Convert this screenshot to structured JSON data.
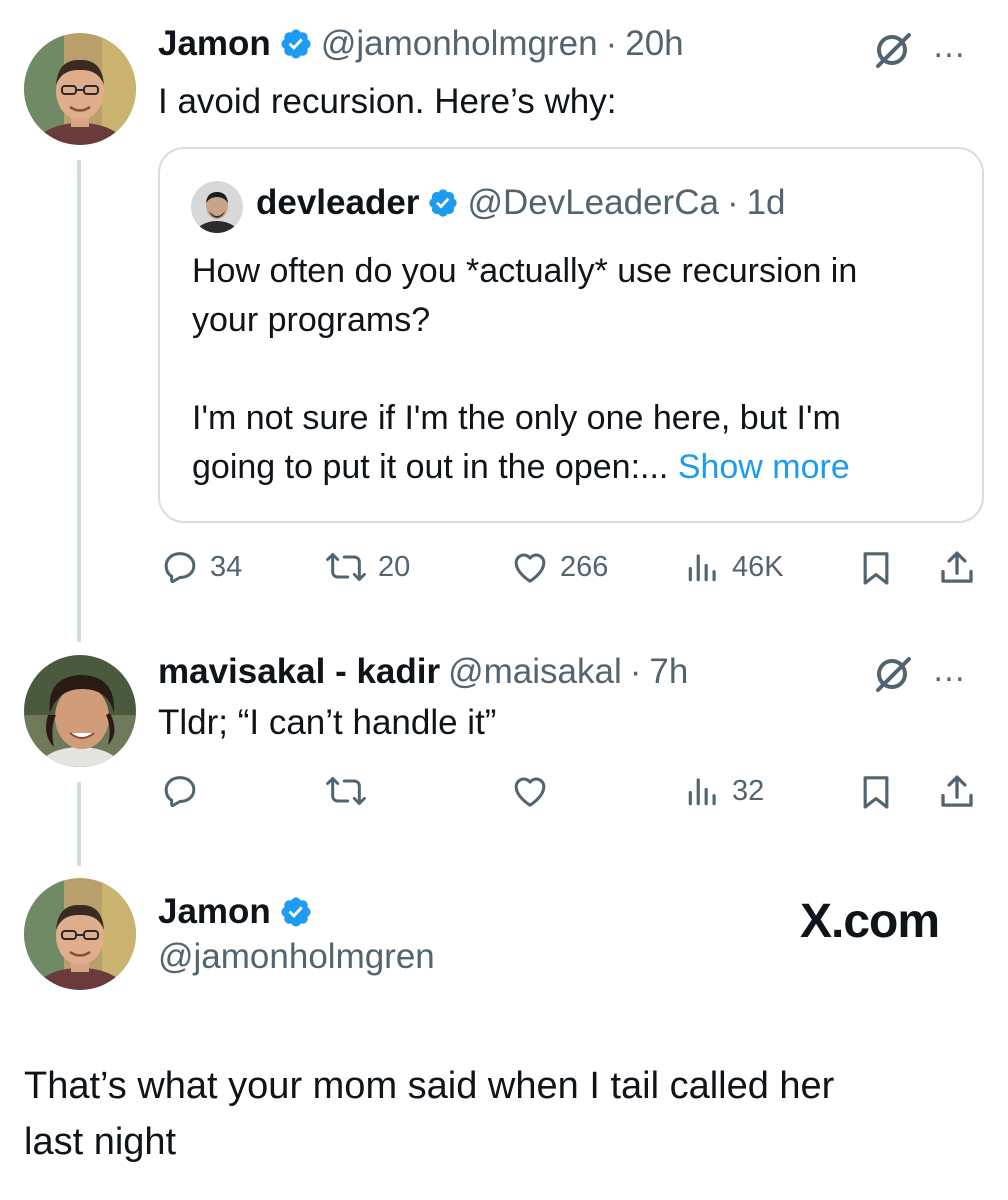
{
  "tweet1": {
    "name": "Jamon",
    "handle": "@jamonholmgren",
    "separator": "·",
    "time": "20h",
    "text": "I avoid recursion. Here’s why:",
    "more_icon": "…"
  },
  "quote": {
    "name": "devleader",
    "handle": "@DevLeaderCa",
    "separator": "·",
    "time": "1d",
    "line1": "How often do you *actually* use recursion in",
    "line2": "your programs?",
    "line3": "I'm not sure if I'm the only one here, but I'm",
    "line4": "going to put it out in the open:...",
    "show_more": "Show more"
  },
  "tweet1_actions": {
    "replies": "34",
    "reposts": "20",
    "likes": "266",
    "views": "46K"
  },
  "tweet2": {
    "name": "mavisakal - kadir",
    "handle": "@maisakal",
    "separator": "·",
    "time": "7h",
    "text": "Tldr; “I can’t handle it”",
    "more_icon": "…"
  },
  "tweet2_actions": {
    "views": "32"
  },
  "card": {
    "name": "Jamon",
    "handle": "@jamonholmgren",
    "watermark": "X.com",
    "line1": "That’s what your mom said when I tail called her",
    "line2": "last night"
  },
  "colors": {
    "accent": "#1d9bf0",
    "muted": "#536471",
    "thread_line": "#cfd9de"
  },
  "icons": [
    "grok-icon",
    "more-icon",
    "verified-badge-icon",
    "reply-icon",
    "repost-icon",
    "like-icon",
    "views-icon",
    "bookmark-icon",
    "share-icon"
  ]
}
